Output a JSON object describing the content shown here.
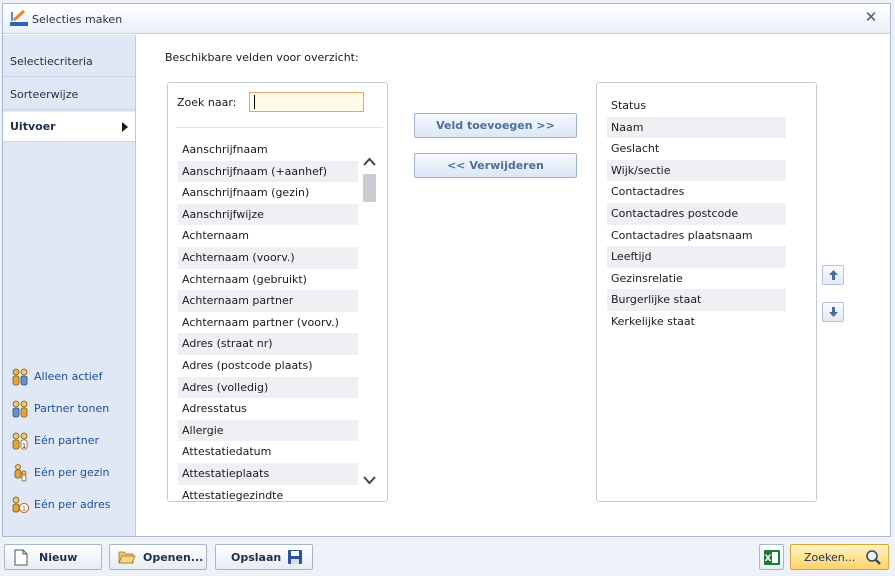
{
  "window": {
    "title": "Selecties maken"
  },
  "sidebar": {
    "nav": [
      {
        "label": "Selectiecriteria"
      },
      {
        "label": "Sorteerwijze"
      },
      {
        "label": "Uitvoer"
      }
    ],
    "actions": [
      {
        "label": "Alleen actief",
        "icon": "two-persons-icon"
      },
      {
        "label": "Partner tonen",
        "icon": "couple-icon"
      },
      {
        "label": "Eén partner",
        "icon": "one-partner-icon"
      },
      {
        "label": "Eén per gezin",
        "icon": "family-icon"
      },
      {
        "label": "Eén per adres",
        "icon": "address-icon"
      }
    ]
  },
  "main": {
    "available_label": "Beschikbare velden voor overzicht:",
    "search": {
      "label": "Zoek naar:",
      "value": ""
    },
    "available_fields": [
      "Aanschrijfnaam",
      "Aanschrijfnaam (+aanhef)",
      "Aanschrijfnaam (gezin)",
      "Aanschrijfwijze",
      "Achternaam",
      "Achternaam (voorv.)",
      "Achternaam (gebruikt)",
      "Achternaam partner",
      "Achternaam partner (voorv.)",
      "Adres (straat nr)",
      "Adres (postcode plaats)",
      "Adres (volledig)",
      "Adresstatus",
      "Allergie",
      "Attestatiedatum",
      "Attestatieplaats",
      "Attestatiegezindte"
    ],
    "add_button": "Veld toevoegen  >>",
    "remove_button": "<<  Verwijderen",
    "selected_fields": [
      "Status",
      "Naam",
      "Geslacht",
      "Wijk/sectie",
      "Contactadres",
      "Contactadres postcode",
      "Contactadres plaatsnaam",
      "Leeftijd",
      "Gezinsrelatie",
      "Burgerlijke staat",
      "Kerkelijke staat"
    ]
  },
  "footer": {
    "new_label": "Nieuw",
    "open_label": "Openen...",
    "save_label": "Opslaan",
    "search_label": "Zoeken..."
  },
  "colors": {
    "accent": "#1d4f9a",
    "highlight": "#ffd36a"
  }
}
